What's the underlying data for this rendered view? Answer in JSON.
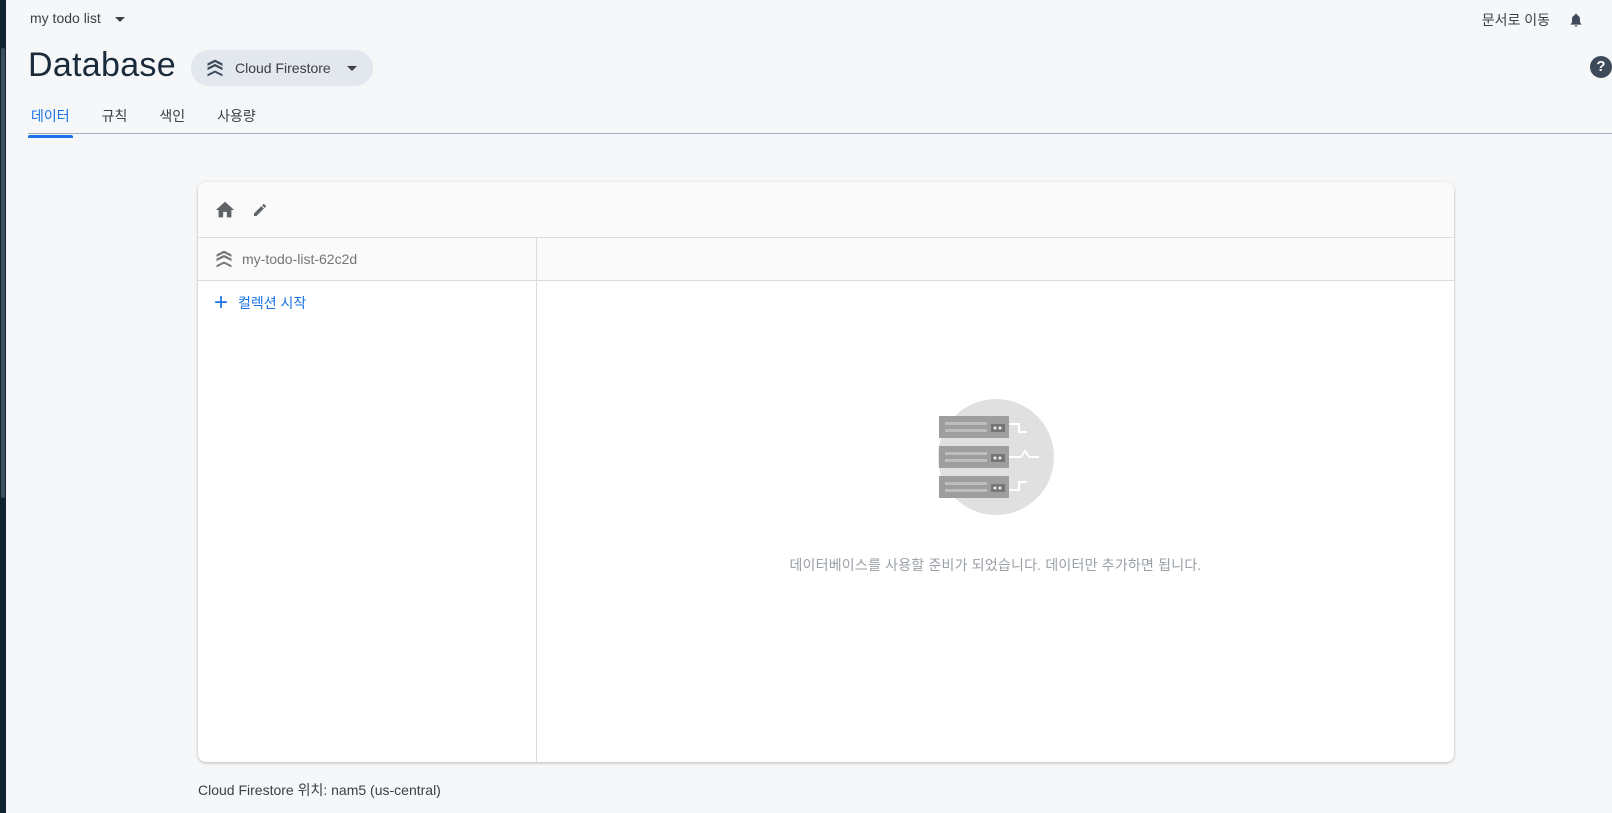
{
  "project": {
    "name": "my todo list"
  },
  "header": {
    "docs_link": "문서로 이동",
    "page_title": "Database",
    "product": "Cloud Firestore"
  },
  "tabs": [
    {
      "label": "데이터",
      "active": true
    },
    {
      "label": "규칙",
      "active": false
    },
    {
      "label": "색인",
      "active": false
    },
    {
      "label": "사용량",
      "active": false
    }
  ],
  "panel": {
    "root_path": "my-todo-list-62c2d",
    "start_collection": "컬렉션 시작",
    "empty_message": "데이터베이스를 사용할 준비가 되었습니다. 데이터만 추가하면 됩니다."
  },
  "footer": {
    "location_text": "Cloud Firestore 위치: nam5 (us-central)"
  },
  "icons": [
    "chevron-down-icon",
    "bell-icon",
    "help-icon",
    "firestore-icon",
    "home-icon",
    "edit-icon",
    "plus-icon",
    "server-illustration"
  ],
  "colors": {
    "accent": "#1a73e8",
    "background": "#f5f7f9",
    "title": "#1a2b3c"
  }
}
